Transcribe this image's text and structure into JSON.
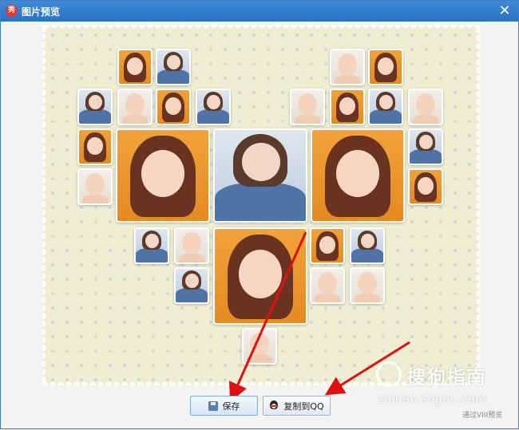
{
  "window": {
    "title": "图片预览",
    "app_icon_glyph": "秀",
    "close_glyph": "✕"
  },
  "buttons": {
    "save_label": "保存",
    "copy_label": "复制到QQ"
  },
  "watermark": {
    "brand": "搜狗指南",
    "url": "zhinan.sogou.com",
    "sub": "通过VIII预览"
  },
  "colors": {
    "titlebar": "#2a71c2",
    "arrow": "#e01010",
    "canvas_bg": "#efeed3"
  },
  "collage": {
    "layout": "heart",
    "photos": [
      {
        "kind": "girl-orange"
      },
      {
        "kind": "denim"
      },
      {
        "kind": "baby"
      },
      {
        "kind": "girl-orange"
      },
      {
        "kind": "denim"
      },
      {
        "kind": "baby"
      },
      {
        "kind": "girl-orange"
      },
      {
        "kind": "denim"
      },
      {
        "kind": "baby"
      },
      {
        "kind": "girl-orange"
      },
      {
        "kind": "denim"
      },
      {
        "kind": "baby"
      },
      {
        "kind": "girl-orange"
      },
      {
        "kind": "denim"
      },
      {
        "kind": "baby"
      },
      {
        "kind": "girl-orange"
      },
      {
        "kind": "denim"
      },
      {
        "kind": "baby"
      },
      {
        "kind": "girl-orange"
      },
      {
        "kind": "denim"
      },
      {
        "kind": "baby"
      },
      {
        "kind": "denim"
      },
      {
        "kind": "baby"
      },
      {
        "kind": "girl-orange"
      },
      {
        "kind": "denim"
      },
      {
        "kind": "girl-orange"
      },
      {
        "kind": "baby"
      }
    ]
  }
}
